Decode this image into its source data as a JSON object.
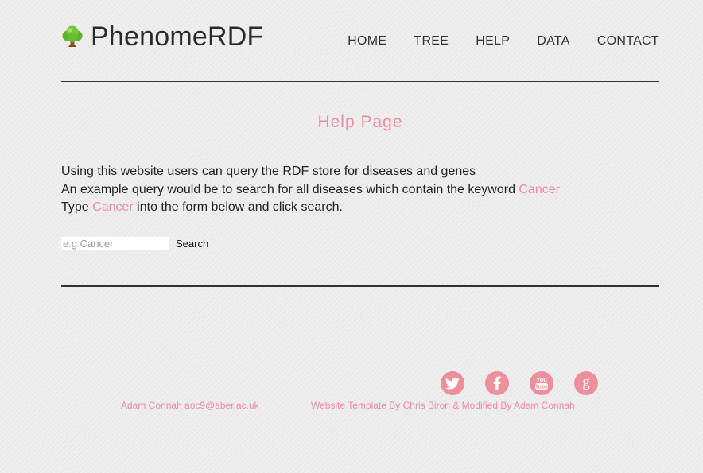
{
  "site": {
    "title": "PhenomeRDF",
    "logo_icon": "tree-icon"
  },
  "nav": {
    "items": [
      {
        "label": "HOME"
      },
      {
        "label": "TREE"
      },
      {
        "label": "HELP"
      },
      {
        "label": "DATA"
      },
      {
        "label": "CONTACT"
      }
    ]
  },
  "main": {
    "heading": "Help Page",
    "line1": "Using this website users can query the RDF store for diseases and genes",
    "line2_prefix": "An example query would be to search for all diseases which contain the keyword ",
    "line2_keyword": "Cancer",
    "line3_prefix": "Type ",
    "line3_keyword": "Cancer",
    "line3_suffix": " into the form below and click search."
  },
  "search": {
    "placeholder": "e.g Cancer",
    "value": "",
    "button_label": "Search"
  },
  "social": {
    "items": [
      {
        "icon": "twitter-icon"
      },
      {
        "icon": "facebook-icon"
      },
      {
        "icon": "youtube-icon"
      },
      {
        "icon": "google-icon"
      }
    ]
  },
  "footer": {
    "author": "Adam Connah aoc9@aber.ac.uk",
    "credit": "Website Template By Chris Biron & Modified By Adam Connah"
  },
  "colors": {
    "accent": "#ef8aa0",
    "social_bg": "#ee8f9e",
    "text": "#222222",
    "background": "#ececec"
  }
}
